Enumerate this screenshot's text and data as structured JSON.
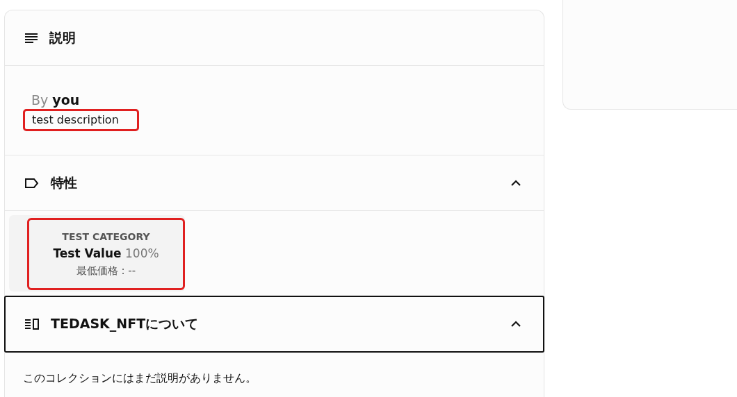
{
  "sections": [
    {
      "kind": "description",
      "title": "説明",
      "focused": false,
      "by_label": "By",
      "author": "you",
      "text": "test description",
      "highlighted": true
    },
    {
      "kind": "traits",
      "title": "特性",
      "expanded": true,
      "focused": false,
      "traits": [
        {
          "category": "TEST CATEGORY",
          "value": "Test Value",
          "percent": "100%",
          "floor_label": "最低価格 : --",
          "highlighted": true
        }
      ]
    },
    {
      "kind": "about",
      "title": "TEDASK_NFTについて",
      "expanded": true,
      "focused": true,
      "text": "このコレクションにはまだ説明がありません。"
    }
  ]
}
